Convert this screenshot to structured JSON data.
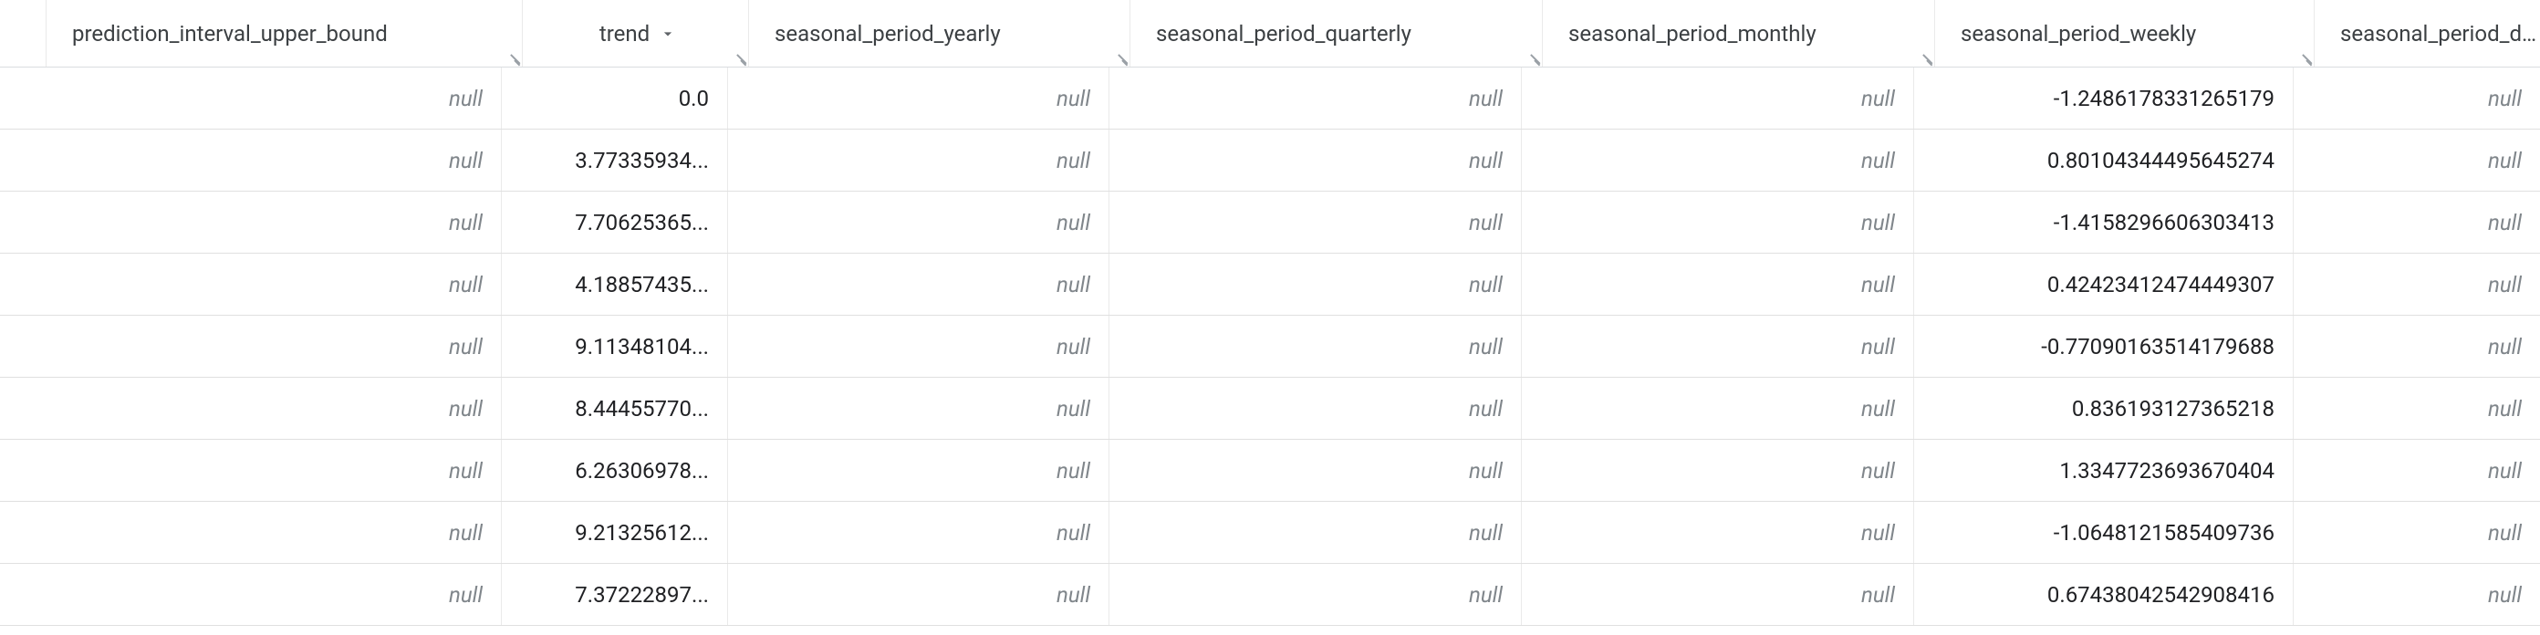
{
  "table": {
    "columns": [
      {
        "key": "ellipsis",
        "label": "."
      },
      {
        "key": "piub",
        "label": "prediction_interval_upper_bound"
      },
      {
        "key": "trend",
        "label": "trend",
        "sorted": true
      },
      {
        "key": "spy",
        "label": "seasonal_period_yearly"
      },
      {
        "key": "spq",
        "label": "seasonal_period_quarterly"
      },
      {
        "key": "spm",
        "label": "seasonal_period_monthly"
      },
      {
        "key": "spw",
        "label": "seasonal_period_weekly"
      },
      {
        "key": "spd",
        "label": "seasonal_period_dail"
      }
    ],
    "null_text": "null",
    "rows": [
      {
        "piub": null,
        "trend": "0.0",
        "spy": null,
        "spq": null,
        "spm": null,
        "spw": "-1.2486178331265179",
        "spd": null
      },
      {
        "piub": null,
        "trend": "3.77335934...",
        "spy": null,
        "spq": null,
        "spm": null,
        "spw": "0.80104344495645274",
        "spd": null
      },
      {
        "piub": null,
        "trend": "7.70625365...",
        "spy": null,
        "spq": null,
        "spm": null,
        "spw": "-1.4158296606303413",
        "spd": null
      },
      {
        "piub": null,
        "trend": "4.18857435...",
        "spy": null,
        "spq": null,
        "spm": null,
        "spw": "0.42423412474449307",
        "spd": null
      },
      {
        "piub": null,
        "trend": "9.11348104...",
        "spy": null,
        "spq": null,
        "spm": null,
        "spw": "-0.77090163514179688",
        "spd": null
      },
      {
        "piub": null,
        "trend": "8.44455770...",
        "spy": null,
        "spq": null,
        "spm": null,
        "spw": "0.836193127365218",
        "spd": null
      },
      {
        "piub": null,
        "trend": "6.26306978...",
        "spy": null,
        "spq": null,
        "spm": null,
        "spw": "1.3347723693670404",
        "spd": null
      },
      {
        "piub": null,
        "trend": "9.21325612...",
        "spy": null,
        "spq": null,
        "spm": null,
        "spw": "-1.0648121585409736",
        "spd": null
      },
      {
        "piub": null,
        "trend": "7.37222897...",
        "spy": null,
        "spq": null,
        "spm": null,
        "spw": "0.67438042542908416",
        "spd": null
      }
    ]
  }
}
